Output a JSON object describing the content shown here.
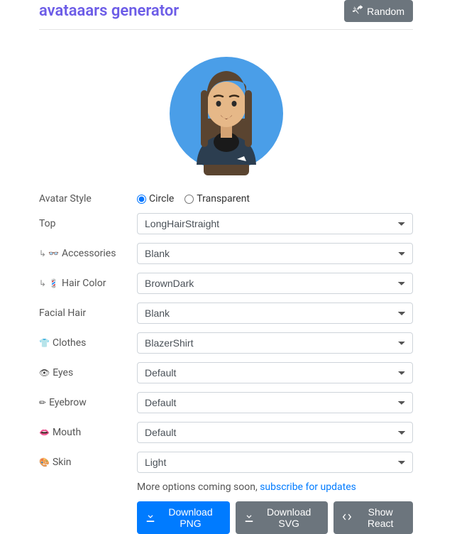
{
  "title": "avataaars generator",
  "random_label": "Random",
  "avatar_style_label": "Avatar Style",
  "radio_circle": "Circle",
  "radio_transparent": "Transparent",
  "avatar_style_selected": "circle",
  "fields": {
    "top": {
      "label": "Top",
      "value": "LongHairStraight",
      "prefix": ""
    },
    "accessories": {
      "label": "Accessories",
      "value": "Blank",
      "prefix": "↳ 👓"
    },
    "haircolor": {
      "label": "Hair Color",
      "value": "BrownDark",
      "prefix": "↳ 💈"
    },
    "facialhair": {
      "label": "Facial Hair",
      "value": "Blank",
      "prefix": ""
    },
    "clothes": {
      "label": "Clothes",
      "value": "BlazerShirt",
      "prefix": "👕"
    },
    "eyes": {
      "label": "Eyes",
      "value": "Default",
      "prefix": "👁"
    },
    "eyebrow": {
      "label": "Eyebrow",
      "value": "Default",
      "prefix": "✏"
    },
    "mouth": {
      "label": "Mouth",
      "value": "Default",
      "prefix": "👄"
    },
    "skin": {
      "label": "Skin",
      "value": "Light",
      "prefix": "🎨"
    }
  },
  "footer_text": "More options coming soon, ",
  "footer_link": "subscribe for updates",
  "btn_png": "Download PNG",
  "btn_svg": "Download SVG",
  "btn_react": "Show React"
}
